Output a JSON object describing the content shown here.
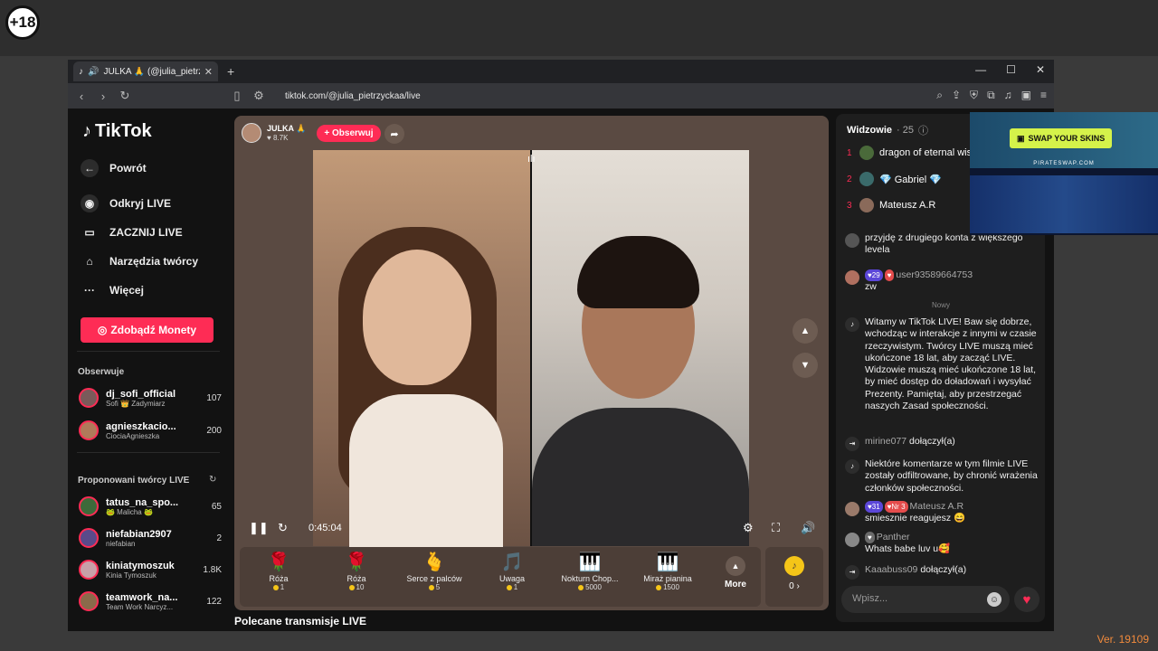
{
  "badge": "+18",
  "version": "Ver. 19109",
  "browser": {
    "tab_title": "JULKA 🙏 (@julia_pietrzyckaa",
    "url": "tiktok.com/@julia_pietrzyckaa/live"
  },
  "sidebar": {
    "logo": "TikTok",
    "back": "Powrót",
    "nav": [
      "Odkryj LIVE",
      "ZACZNIJ LIVE",
      "Narzędzia twórcy",
      "Więcej"
    ],
    "coins_button": "Zdobądź Monety",
    "following_title": "Obserwuje",
    "following": [
      {
        "name": "dj_sofi_official",
        "sub": "Sofi 👑 Zadymiarz",
        "count": "107"
      },
      {
        "name": "agnieszkacio...",
        "sub": "CiociaAgnieszka",
        "count": "200"
      }
    ],
    "suggested_title": "Proponowani twórcy LIVE",
    "suggested": [
      {
        "name": "tatus_na_spo...",
        "sub": "🐸 Malicha 🐸",
        "count": "65"
      },
      {
        "name": "niefabian2907",
        "sub": "niefabian",
        "count": "2"
      },
      {
        "name": "kiniatymoszuk",
        "sub": "Kinia Tymoszuk",
        "count": "1.8K"
      },
      {
        "name": "teamwork_na...",
        "sub": "Team Work Narcyz...",
        "count": "122"
      }
    ]
  },
  "stream": {
    "host_name": "JULKA 🙏",
    "host_likes": "♥ 8.7K",
    "follow": "+ Obserwuj",
    "time": "0:45:04",
    "gifts": [
      {
        "icon": "🌹",
        "name": "Róża",
        "price": "1"
      },
      {
        "icon": "🌹",
        "name": "Róża",
        "price": "10"
      },
      {
        "icon": "🫰",
        "name": "Serce z palców",
        "price": "5"
      },
      {
        "icon": "🎵",
        "name": "Uwaga",
        "price": "1"
      },
      {
        "icon": "🎹",
        "name": "Nokturn Chop...",
        "price": "5000"
      },
      {
        "icon": "🎹",
        "name": "Miraż pianina",
        "price": "1500"
      }
    ],
    "more": "More",
    "coins": "0 ›",
    "recommended": "Polecane transmisje LIVE"
  },
  "chat": {
    "viewers_label": "Widzowie",
    "viewers_count": "· 25",
    "viewers": [
      {
        "rank": "1",
        "name": "dragon of eternal wis..."
      },
      {
        "rank": "2",
        "name": "💎 Gabriel 💎"
      },
      {
        "rank": "3",
        "name": "Mateusz A.R"
      }
    ],
    "partial_msg": "przyjdę z drugiego konta z większego levela",
    "msg_user1": "user93589664753",
    "msg_user1_lvl": "29",
    "msg_user1_text": "zw",
    "now_label": "Nowy",
    "welcome": "Witamy w TikTok LIVE! Baw się dobrze, wchodząc w interakcje z innymi w czasie rzeczywistym. Twórcy LIVE muszą mieć ukończone 18 lat, aby zacząć LIVE. Widzowie muszą mieć ukończone 18 lat, by mieć dostęp do doładowań i wysyłać Prezenty. Pamiętaj, aby przestrzegać naszych Zasad społeczności.",
    "join1_user": "mirine077",
    "join_text": "dołączył(a)",
    "filter_notice": "Niektóre komentarze w tym filmie LIVE zostały odfiltrowane, by chronić wrażenia członków społeczności.",
    "msg2_lvl": "31",
    "msg2_rank": "Nr 3",
    "msg2_user": "Mateusz A.R",
    "msg2_text": "smiesznie reagujesz 😄",
    "msg3_user": "Panther",
    "msg3_text": "Whats babe luv u🥰",
    "join2_user": "Kaaabuss09",
    "input_placeholder": "Wpisz..."
  },
  "ad": {
    "button": "SWAP YOUR SKINS",
    "brand": "PIRATESWAP.COM"
  }
}
